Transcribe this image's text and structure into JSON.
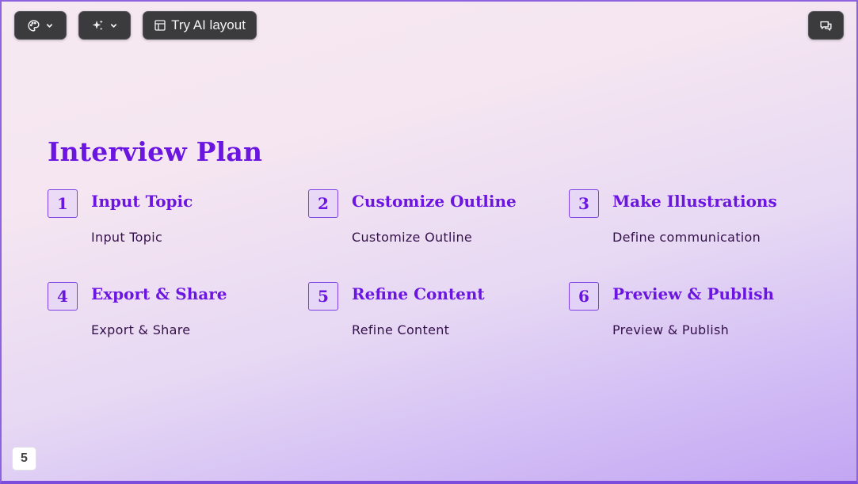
{
  "toolbar": {
    "theme_icon": "palette-icon",
    "ai_icon": "sparkles-icon",
    "layout_icon": "layout-icon",
    "layout_label": "Try AI layout",
    "chat_icon": "chat-icon"
  },
  "slide": {
    "title": "Interview Plan",
    "steps": [
      {
        "number": "1",
        "title": "Input Topic",
        "description": "Input Topic"
      },
      {
        "number": "2",
        "title": "Customize Outline",
        "description": "Customize Outline"
      },
      {
        "number": "3",
        "title": "Make Illustrations",
        "description": "Define communication"
      },
      {
        "number": "4",
        "title": "Export & Share",
        "description": "Export & Share"
      },
      {
        "number": "5",
        "title": "Refine Content",
        "description": "Refine Content"
      },
      {
        "number": "6",
        "title": "Preview & Publish",
        "description": "Preview & Publish"
      }
    ],
    "page_number": "5"
  },
  "colors": {
    "accent": "#6b16e0",
    "text_dark": "#34104a",
    "toolbar_bg": "#3b3a3d"
  }
}
